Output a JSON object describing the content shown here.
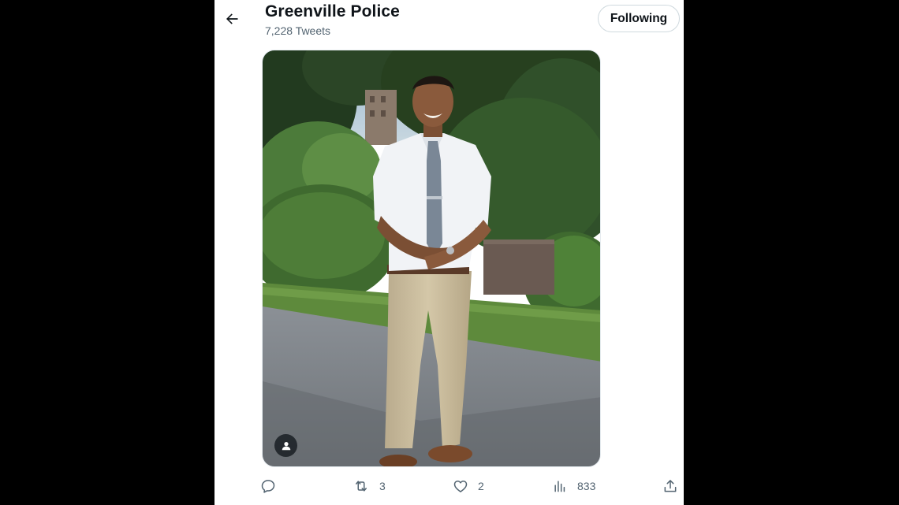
{
  "header": {
    "account_name": "Greenville Police",
    "tweet_count": "7,228 Tweets",
    "follow_label": "Following"
  },
  "actions": {
    "retweets": "3",
    "likes": "2",
    "views": "833"
  },
  "icons": {
    "back": "back-arrow-icon",
    "person_tag": "person-icon",
    "reply": "reply-icon",
    "retweet": "retweet-icon",
    "like": "heart-icon",
    "views": "views-chart-icon",
    "share": "share-icon"
  },
  "colors": {
    "text_primary": "#0f1419",
    "text_secondary": "#536471",
    "border": "#cfd9de"
  }
}
